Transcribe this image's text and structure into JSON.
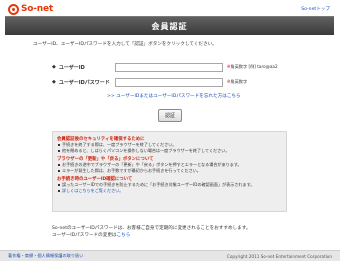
{
  "header": {
    "logo_text": "So-net",
    "top_link": "So-netトップ",
    "title": "会員認証"
  },
  "intro_text": "ユーザーID、ユーザーIDパスワードを入力して「認証」ボタンをクリックしてください。",
  "form": {
    "bullet": "◆",
    "user_id_label": "ユーザーID",
    "user_id_value": "",
    "user_id_note_star": "※",
    "user_id_note": "角英数字 [例] taro@aa2",
    "password_label": "ユーザーIDパスワード",
    "password_value": "",
    "password_note_star": "※",
    "password_note": "角英数字",
    "forgot_link": ">> ユーザーIDまたはユーザーIDパスワードを忘れた方はこちら",
    "submit_label": "認証"
  },
  "info": {
    "sections": [
      {
        "heading": "会員認証後のセキュリティを確保するために",
        "items": [
          "手続きを終了する際は、一度ブラウザーを終了してください。",
          "他を閉めると、しばらくパソコンを操作しない場合は一度ブラウザーを終了してください。"
        ]
      },
      {
        "heading": "ブラウザーの「更新」や「戻る」ボタンについて",
        "items": [
          "お手続きの途中でブラウザーの「更新」や「戻る」ボタンを押すとエラーとなる場合があります。",
          "エラーが発生した際は、お手数ですが最初からお手続きを行ってください。"
        ]
      },
      {
        "heading": "お手続き時のユーザーID確認について",
        "items": [
          "誤ったユーザーIDでの手続きを防止するために「お手続き対象ユーザーIDの確認画面」が表示されます。",
          "詳しくはこちらをご覧ください。"
        ]
      }
    ]
  },
  "footer": {
    "line1": "So-netのユーザーIDパスワードは、お客様ご自身で定期的に変更されることをおすすめします。",
    "line2": "ユーザーIDパスワードの変更は",
    "line2_link": "こちら",
    "links": "著作権・商標・個人情報保護の取り扱い",
    "copyright": "Copyright 2011 So-net Entertainment Corporation"
  }
}
